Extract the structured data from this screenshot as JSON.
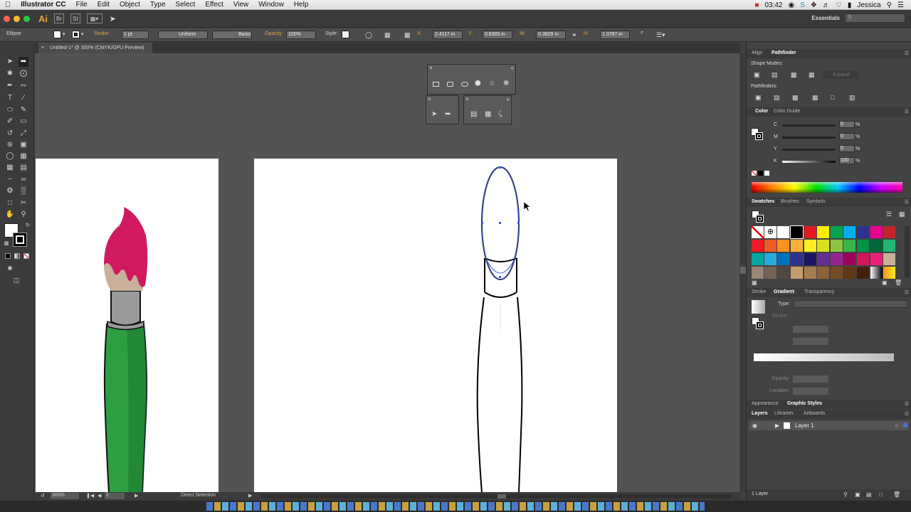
{
  "menubar": {
    "app_name": "Illustrator CC",
    "items": [
      "File",
      "Edit",
      "Object",
      "Type",
      "Select",
      "Effect",
      "View",
      "Window",
      "Help"
    ],
    "clock": "03:42",
    "user": "Jessica"
  },
  "appbar": {
    "logo": "Ai",
    "br_label": "Br",
    "st_label": "St",
    "workspace": "Essentials",
    "search_placeholder": ""
  },
  "control": {
    "selection": "Ellipse",
    "stroke_label": "Stroke:",
    "stroke_weight": "1 pt",
    "profile": "Uniform",
    "brush": "Basic",
    "opacity_label": "Opacity:",
    "opacity": "100%",
    "style_label": "Style:",
    "x_label": "X:",
    "x": "2.4117 in",
    "y_label": "Y:",
    "y": "0.6305 in",
    "w_label": "W:",
    "w": "0.3829 in",
    "h_label": "H:",
    "h": "1.0787 in"
  },
  "document": {
    "tab_title": "Untitled-1* @ 300% (CMYK/GPU Preview)",
    "zoom": "300%",
    "page": "2",
    "status_tool": "Direct Selection"
  },
  "panels": {
    "align_tab": "Align",
    "pathfinder_tab": "Pathfinder",
    "shape_modes": "Shape Modes:",
    "expand": "Expand",
    "pathfinders": "Pathfinders:",
    "color_tab": "Color",
    "color_guide_tab": "Color Guide",
    "cmyk": [
      {
        "label": "C",
        "value": "0"
      },
      {
        "label": "M",
        "value": "0"
      },
      {
        "label": "Y",
        "value": "0"
      },
      {
        "label": "K",
        "value": "100"
      }
    ],
    "percent": "%",
    "swatches_tab": "Swatches",
    "brushes_tab": "Brushes",
    "symbols_tab": "Symbols",
    "stroke_tab": "Stroke",
    "gradient_tab": "Gradient",
    "transparency_tab": "Transparency",
    "type_label": "Type:",
    "stroke_label": "Stroke:",
    "opacity_label": "Opacity:",
    "location_label": "Location:",
    "appearance_tab": "Appearance",
    "graphic_styles_tab": "Graphic Styles",
    "layers_tab": "Layers",
    "libraries_tab": "Libraries",
    "artboards_tab": "Artboards",
    "layer_name": "Layer 1",
    "layer_count": "1 Layer"
  },
  "colors": {
    "accent": "#3b5bdb",
    "paint_pink": "#d0195f",
    "handle_green": "#2ea043"
  }
}
